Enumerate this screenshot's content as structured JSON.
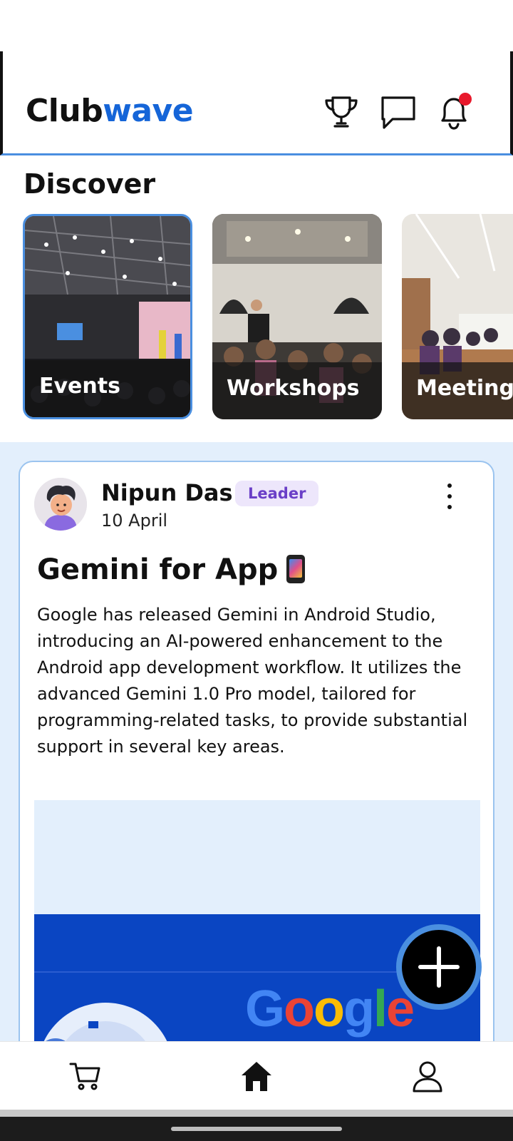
{
  "header": {
    "brand_part1": "Club",
    "brand_part2": "wave",
    "icons": [
      "trophy-icon",
      "chat-icon",
      "bell-icon"
    ],
    "has_notification": true,
    "accent_color": "#1565d8"
  },
  "discover": {
    "title": "Discover",
    "categories": [
      {
        "label": "Events",
        "selected": true
      },
      {
        "label": "Workshops",
        "selected": false
      },
      {
        "label": "Meetings",
        "selected": false
      }
    ]
  },
  "post": {
    "author": "Nipun Das",
    "role_badge": "Leader",
    "date": "10 April",
    "title": "Gemini for App",
    "title_emoji": "mobile-phone",
    "body": "Google has released Gemini in Android Studio, introducing an AI-powered enhancement to the Android app development workflow. It utilizes the advanced Gemini 1.0 Pro model, tailored for programming-related tasks, to provide substantial support in several key areas.",
    "image_text": "Google"
  },
  "fab": {
    "icon": "plus-icon"
  },
  "bottom_nav": {
    "items": [
      "cart-icon",
      "home-icon",
      "profile-icon"
    ]
  },
  "colors": {
    "feed_background": "#e3effc",
    "card_border": "#9bc4ef",
    "badge_bg": "#ede6fb",
    "badge_text": "#6a3fc7",
    "notification_dot": "#e8192c"
  }
}
